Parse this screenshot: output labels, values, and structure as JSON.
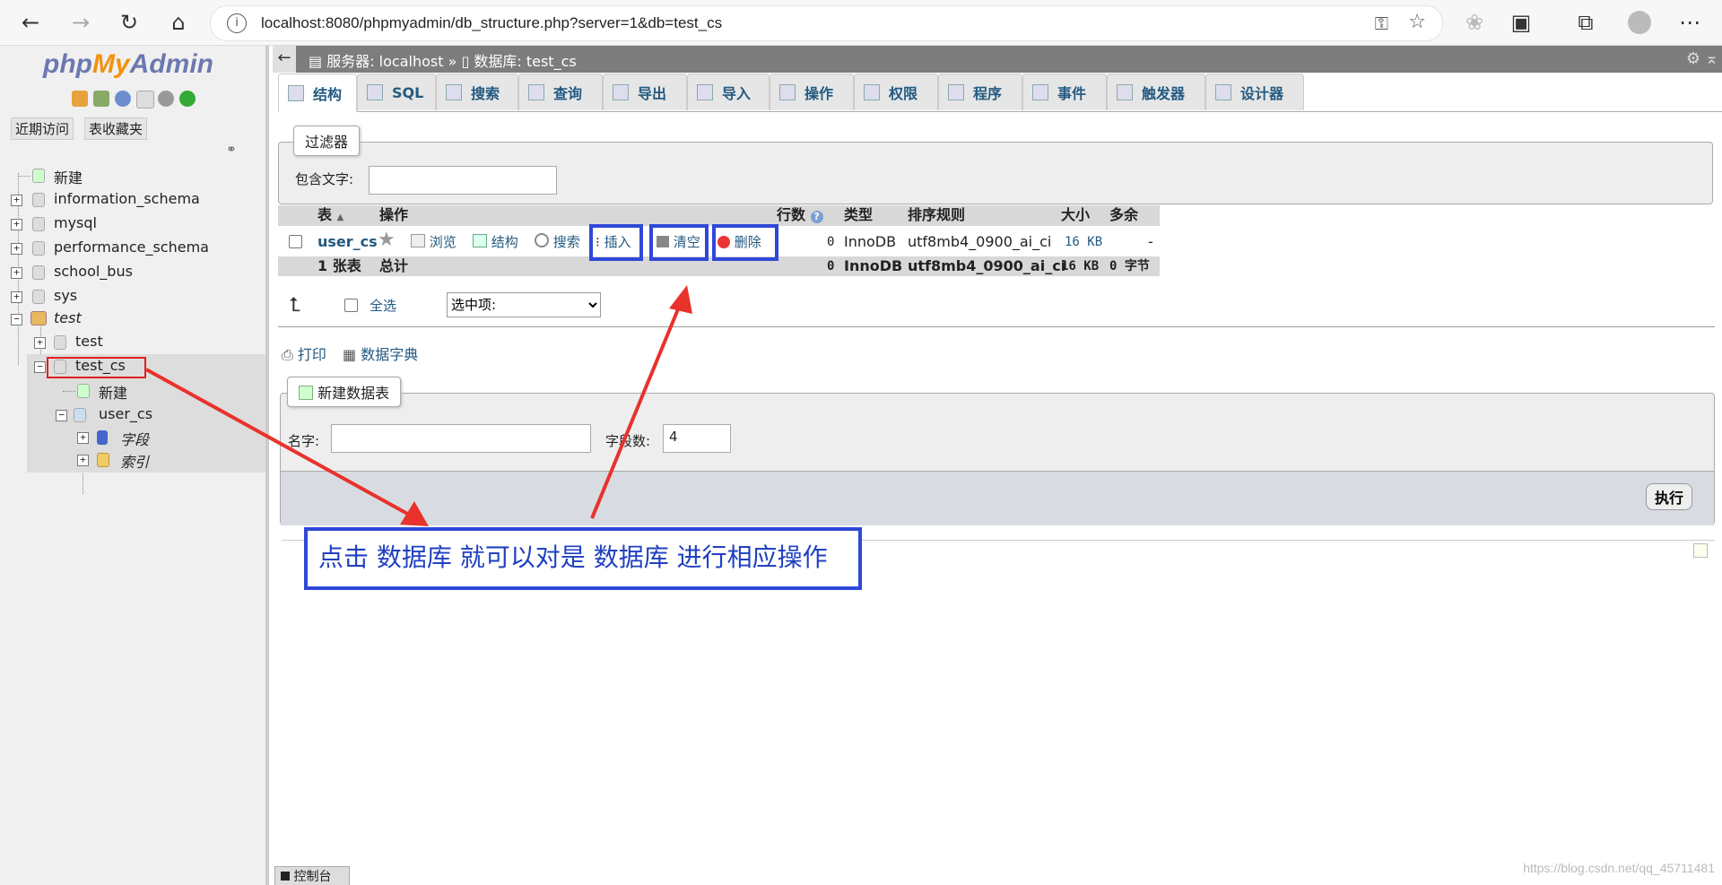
{
  "browser": {
    "url": "localhost:8080/phpmyadmin/db_structure.php?server=1&db=test_cs"
  },
  "left": {
    "logo": {
      "php": "php",
      "my": "My",
      "admin": "Admin"
    },
    "tabs": [
      "近期访问",
      "表收藏夹"
    ],
    "tree": [
      {
        "label": "新建"
      },
      {
        "label": "information_schema"
      },
      {
        "label": "mysql"
      },
      {
        "label": "performance_schema"
      },
      {
        "label": "school_bus"
      },
      {
        "label": "sys"
      },
      {
        "label": "test"
      },
      {
        "label": "test"
      },
      {
        "label": "test_cs"
      },
      {
        "label": "新建"
      },
      {
        "label": "user_cs"
      },
      {
        "label": "字段"
      },
      {
        "label": "索引"
      }
    ]
  },
  "header": {
    "breadcrumb_server": "服务器: localhost »",
    "breadcrumb_db": "数据库: test_cs"
  },
  "tabs": [
    {
      "label": "结构"
    },
    {
      "label": "SQL"
    },
    {
      "label": "搜索"
    },
    {
      "label": "查询"
    },
    {
      "label": "导出"
    },
    {
      "label": "导入"
    },
    {
      "label": "操作"
    },
    {
      "label": "权限"
    },
    {
      "label": "程序"
    },
    {
      "label": "事件"
    },
    {
      "label": "触发器"
    },
    {
      "label": "设计器"
    }
  ],
  "filter": {
    "legend": "过滤器",
    "label": "包含文字:"
  },
  "table": {
    "headers": {
      "table": "表",
      "action": "操作",
      "rows": "行数",
      "type": "类型",
      "collation": "排序规则",
      "size": "大小",
      "overhead": "多余"
    },
    "row": {
      "name": "user_cs",
      "browse": "浏览",
      "structure": "结构",
      "search": "搜索",
      "insert": "插入",
      "empty": "清空",
      "drop": "删除",
      "rows": "0",
      "type": "InnoDB",
      "collation": "utf8mb4_0900_ai_ci",
      "size": "16 KB",
      "overhead": "-"
    },
    "footer": {
      "count": "1 张表",
      "sum": "总计",
      "rows": "0",
      "type": "InnoDB",
      "collation": "utf8mb4_0900_ai_ci",
      "size": "16 KB",
      "overhead": "0 字节"
    }
  },
  "bulk": {
    "check_all": "全选",
    "with_selected": "选中项:"
  },
  "links": {
    "print": "打印",
    "dictionary": "数据字典"
  },
  "create": {
    "legend": "新建数据表",
    "name_label": "名字:",
    "cols_label": "字段数:",
    "cols_value": "4",
    "go": "执行"
  },
  "annotation": "点击 数据库 就可以对是 数据库 进行相应操作",
  "console": "控制台",
  "watermark": "https://blog.csdn.net/qq_45711481",
  "colors": {
    "accent": "#2f48d8",
    "arrow": "#e8322c",
    "link": "#235a81"
  }
}
